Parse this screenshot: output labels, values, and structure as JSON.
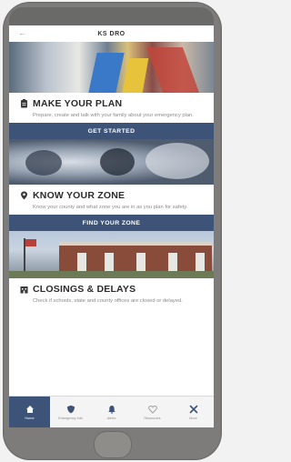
{
  "header": {
    "title": "KS DRO",
    "back_icon": "back-arrow-icon"
  },
  "sections": [
    {
      "title": "MAKE YOUR PLAN",
      "description": "Prepare, create and talk with your family about your emergency plan.",
      "icon": "checklist-icon",
      "cta": "GET STARTED"
    },
    {
      "title": "KNOW YOUR ZONE",
      "description": "Know your county and what zone you are in as you plan for safety.",
      "icon": "location-icon",
      "cta": "FIND YOUR ZONE"
    },
    {
      "title": "CLOSINGS & DELAYS",
      "description": "Check if schools, state and county offices are closed or delayed.",
      "icon": "building-icon"
    }
  ],
  "nav": [
    {
      "label": "Home",
      "icon": "home-icon"
    },
    {
      "label": "Emergency Info",
      "icon": "shield-icon"
    },
    {
      "label": "Alerts",
      "icon": "bell-icon"
    },
    {
      "label": "Resources",
      "icon": "heart-icon"
    },
    {
      "label": "More",
      "icon": "tools-icon"
    }
  ],
  "colors": {
    "accent": "#3d5478",
    "frame": "#7d7c7a"
  }
}
